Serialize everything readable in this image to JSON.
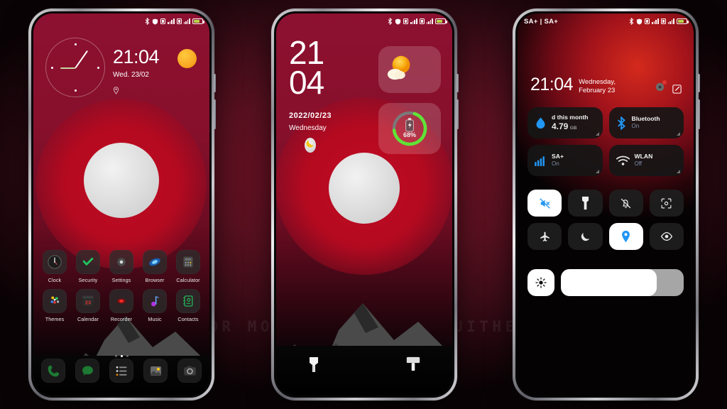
{
  "watermark": "VISIT FOR MORE THEMES - MIUITHEMER.COM",
  "theme": {
    "sky_red": "#8d1030",
    "glow_red": "#c00a22",
    "moon_gray": "#dcdcdc",
    "accent_blue": "#2196f3",
    "battery_green": "#5fe336",
    "sun_yellow": "#f9a825"
  },
  "phone1": {
    "name": "home-screen",
    "statusbar": {
      "icons": [
        "bluetooth-icon",
        "shield-icon",
        "sim1-icon",
        "signal1-icon",
        "sim2-icon",
        "signal2-icon",
        "battery-icon"
      ]
    },
    "clock_widget": {
      "name": "analog-clock-widget"
    },
    "time": "21:04",
    "date": "Wed. 23/02",
    "location_icon": "location-pin-icon",
    "sun_icon": "sun-icon",
    "apps_row1": [
      {
        "label": "Clock",
        "icon": "clock-icon"
      },
      {
        "label": "Security",
        "icon": "shield-check-icon"
      },
      {
        "label": "Settings",
        "icon": "settings-gear-icon"
      },
      {
        "label": "Browser",
        "icon": "browser-globe-icon"
      },
      {
        "label": "Calculator",
        "icon": "calculator-icon"
      }
    ],
    "apps_row2": [
      {
        "label": "Themes",
        "icon": "themes-dots-icon"
      },
      {
        "label": "Calendar",
        "icon": "calendar-icon",
        "day": "23"
      },
      {
        "label": "Recorder",
        "icon": "recorder-icon"
      },
      {
        "label": "Music",
        "icon": "music-note-icon"
      },
      {
        "label": "Contacts",
        "icon": "contacts-icon"
      }
    ],
    "page_dots": {
      "count": 3,
      "active": 2
    },
    "dock": [
      {
        "icon": "phone-icon"
      },
      {
        "icon": "messages-icon"
      },
      {
        "icon": "notes-list-icon"
      },
      {
        "icon": "gallery-icon"
      },
      {
        "icon": "camera-icon"
      }
    ]
  },
  "phone2": {
    "name": "lock-screen",
    "hour": "21",
    "minute": "04",
    "date": "2022/02/23",
    "weekday": "Wednesday",
    "moon_icon": "crescent-moon-icon",
    "weather_widget": {
      "icon": "sun-cloud-icon"
    },
    "battery_widget": {
      "percent": "68%",
      "value": 68,
      "icon": "battery-charging-icon"
    },
    "shortcut_left": "flashlight-icon",
    "shortcut_right": "camera-icon"
  },
  "phone3": {
    "name": "control-center",
    "carrier": "SA+ | SA+",
    "time": "21:04",
    "date": "Wednesday, February 23",
    "header_icons": [
      "settings-badge-icon",
      "edit-icon"
    ],
    "tiles": [
      {
        "title": "d this month",
        "value": "4.79",
        "unit": "GB",
        "icon": "data-drop-icon"
      },
      {
        "title": "Bluetooth",
        "status": "On",
        "icon": "bluetooth-icon"
      },
      {
        "title": "SA+",
        "status": "On",
        "icon": "signal-bars-icon"
      },
      {
        "title": "WLAN",
        "status": "Off",
        "icon": "wifi-icon"
      }
    ],
    "toggles_row1": [
      {
        "icon": "sound-off-icon",
        "active": true
      },
      {
        "icon": "flashlight-icon",
        "active": false
      },
      {
        "icon": "vibrate-off-icon",
        "active": false
      },
      {
        "icon": "screenshot-icon",
        "active": false
      }
    ],
    "toggles_row2": [
      {
        "icon": "airplane-icon",
        "active": false
      },
      {
        "icon": "dark-mode-moon-icon",
        "active": false
      },
      {
        "icon": "location-pin-icon",
        "active": true
      },
      {
        "icon": "reading-eye-icon",
        "active": false
      }
    ],
    "brightness": {
      "icon": "brightness-sun-icon",
      "value": 78
    }
  }
}
